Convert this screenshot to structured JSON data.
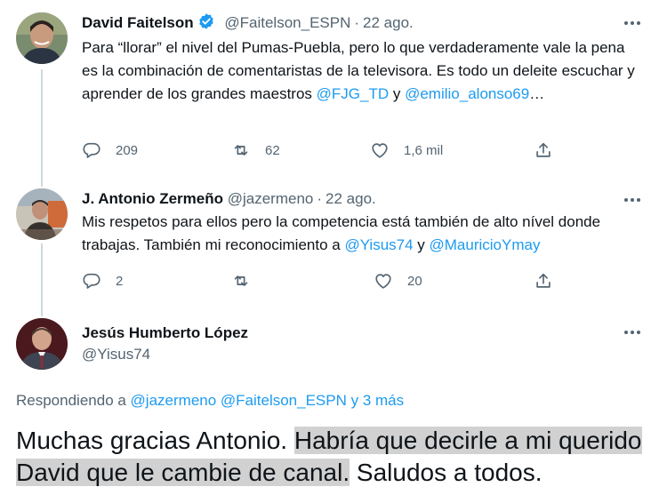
{
  "tweets": [
    {
      "name": "David Faitelson",
      "handle": "@Faitelson_ESPN",
      "date": "22 ago.",
      "text_1": "Para “llorar” el nivel del Pumas-Puebla, pero lo que verdaderamente vale la pena es la combinación de comentaristas de la televisora. Es todo un deleite escuchar y aprender de los grandes maestros ",
      "mention_1": "@FJG_TD",
      "text_2": " y ",
      "mention_2": "@emilio_alonso69",
      "text_3": "…",
      "replies": "209",
      "retweets": "62",
      "likes": "1,6 mil"
    },
    {
      "name": "J. Antonio Zermeño",
      "handle": "@jazermeno",
      "date": "22 ago.",
      "text_1": "Mis respetos para ellos pero la competencia está también de alto nível donde trabajas. También mi reconocimiento a ",
      "mention_1": "@Yisus74",
      "text_2": " y ",
      "mention_2": "@MauricioYmay",
      "replies": "2",
      "retweets": "",
      "likes": "20"
    },
    {
      "name": "Jesús Humberto López",
      "handle": "@Yisus74",
      "replying_prefix": "Respondiendo a ",
      "replying_to": "@jazermeno @Faitelson_ESPN y 3 más",
      "text_plain_1": "Muchas gracias Antonio. ",
      "text_highlight": "Habría que decirle a mi querido David que le cambie de canal.",
      "text_plain_2": " Saludos a todos."
    }
  ],
  "colors": {
    "accent": "#1d9bf0",
    "muted": "#536471",
    "highlight": "#d1d1d1",
    "thread_line": "#cfd9de"
  },
  "icons": [
    "reply-icon",
    "retweet-icon",
    "like-icon",
    "share-icon",
    "more-icon",
    "verified-icon"
  ]
}
